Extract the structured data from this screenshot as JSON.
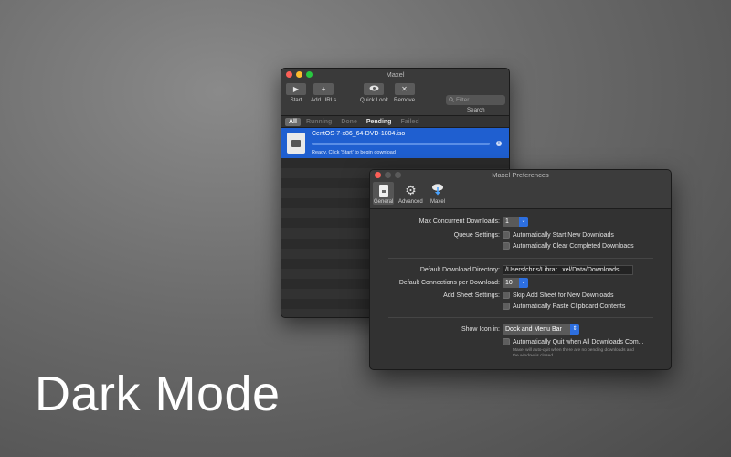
{
  "hero": {
    "text": "Dark Mode"
  },
  "main_window": {
    "title": "Maxel",
    "toolbar": {
      "start_label": "Start",
      "add_urls_label": "Add URLs",
      "quick_look_label": "Quick Look",
      "remove_label": "Remove",
      "search_placeholder": "Filter",
      "search_label": "Search"
    },
    "filter_tabs": [
      "All",
      "Running",
      "Done",
      "Pending",
      "Failed"
    ],
    "downloads": [
      {
        "name": "CentOS-7-x86_64-DVD-1804.iso",
        "status": "Ready. Click 'Start' to begin download",
        "progress": 0
      }
    ]
  },
  "prefs_window": {
    "title": "Maxel Preferences",
    "tabs": [
      "General",
      "Advanced",
      "Maxel"
    ],
    "max_concurrent": {
      "label": "Max Concurrent Downloads:",
      "value": "1"
    },
    "queue": {
      "label": "Queue Settings:",
      "auto_start": "Automatically Start New Downloads",
      "auto_clear": "Automatically Clear Completed Downloads"
    },
    "download_dir": {
      "label": "Default Download Directory:",
      "value": "/Users/chris/Librar...xel/Data/Downloads"
    },
    "connections": {
      "label": "Default Connections per Download:",
      "value": "10"
    },
    "add_sheet": {
      "label": "Add Sheet Settings:",
      "skip": "Skip Add Sheet for New Downloads",
      "paste": "Automatically Paste Clipboard Contents"
    },
    "show_icon": {
      "label": "Show Icon in:",
      "value": "Dock and Menu Bar"
    },
    "auto_quit": {
      "label": "Automatically Quit when All Downloads Com...",
      "note_1": "Maxel will auto-quit when there are no pending downloads and",
      "note_2": "the window is closed."
    }
  }
}
